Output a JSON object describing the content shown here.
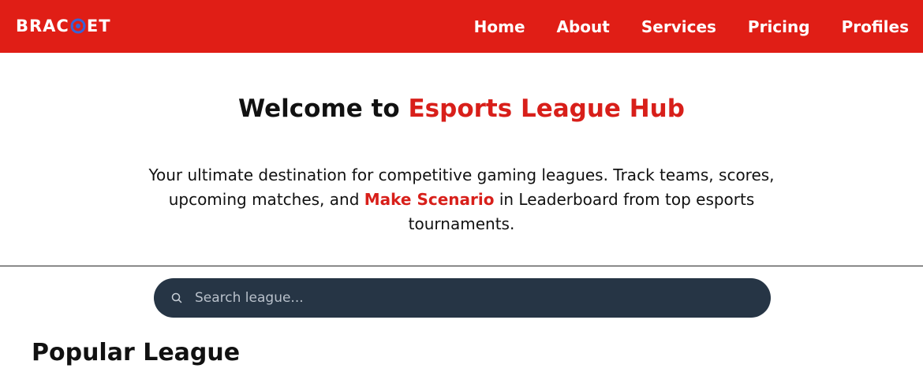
{
  "brand": {
    "logo_prefix": "BRAC",
    "logo_suffix": "ET"
  },
  "nav": {
    "items": [
      {
        "label": "Home"
      },
      {
        "label": "About"
      },
      {
        "label": "Services"
      },
      {
        "label": "Pricing"
      },
      {
        "label": "Profiles"
      }
    ]
  },
  "hero": {
    "title_plain": "Welcome to ",
    "title_accent": "Esports League Hub",
    "text_before": "Your ultimate destination for competitive gaming leagues. Track teams, scores, upcoming matches, and ",
    "text_accent": "Make Scenario",
    "text_after": " in Leaderboard from top esports tournaments."
  },
  "search": {
    "placeholder": "Search league..."
  },
  "popular": {
    "title": "Popular League"
  },
  "colors": {
    "brand_red": "#e01e16",
    "accent_red": "#d81f1a",
    "search_bg": "#263545",
    "logo_ring": "#3a62d6"
  }
}
